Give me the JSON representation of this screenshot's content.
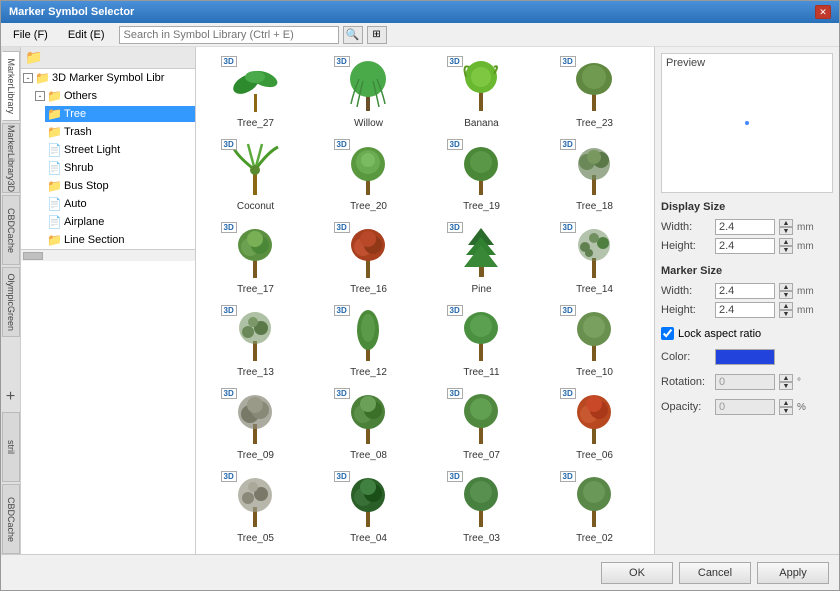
{
  "window": {
    "title": "Marker Symbol Selector",
    "close_btn": "✕"
  },
  "menu": {
    "file": "File (F)",
    "edit": "Edit (E)",
    "search_placeholder": "Search in Symbol Library (Ctrl + E)"
  },
  "tree": {
    "root": "3D Marker Symbol Libr",
    "items": [
      {
        "label": "Others",
        "type": "folder",
        "level": 1
      },
      {
        "label": "Tree",
        "type": "folder",
        "level": 2,
        "selected": true
      },
      {
        "label": "Trash",
        "type": "folder",
        "level": 2
      },
      {
        "label": "Street Light",
        "type": "folder",
        "level": 2
      },
      {
        "label": "Shrub",
        "type": "folder",
        "level": 2
      },
      {
        "label": "Bus Stop",
        "type": "folder",
        "level": 2
      },
      {
        "label": "Auto",
        "type": "folder",
        "level": 2
      },
      {
        "label": "Airplane",
        "type": "folder",
        "level": 2
      },
      {
        "label": "Line Section",
        "type": "folder",
        "level": 2
      }
    ]
  },
  "symbols": [
    {
      "label": "Tree_27",
      "badge": "3D",
      "shape": "palm"
    },
    {
      "label": "Willow",
      "badge": "3D",
      "shape": "willow"
    },
    {
      "label": "Banana",
      "badge": "3D",
      "shape": "banana"
    },
    {
      "label": "Tree_23",
      "badge": "3D",
      "shape": "roundtree"
    },
    {
      "label": "Coconut",
      "badge": "3D",
      "shape": "coconut"
    },
    {
      "label": "Tree_20",
      "badge": "3D",
      "shape": "roundtree2"
    },
    {
      "label": "Tree_19",
      "badge": "3D",
      "shape": "roundtree3"
    },
    {
      "label": "Tree_18",
      "badge": "3D",
      "shape": "roundtree4"
    },
    {
      "label": "Tree_17",
      "badge": "3D",
      "shape": "greentree"
    },
    {
      "label": "Tree_16",
      "badge": "3D",
      "shape": "redtree"
    },
    {
      "label": "Pine",
      "badge": "3D",
      "shape": "pinetree"
    },
    {
      "label": "Tree_14",
      "badge": "3D",
      "shape": "sparsetree"
    },
    {
      "label": "Tree_13",
      "badge": "3D",
      "shape": "sparsetree2"
    },
    {
      "label": "Tree_12",
      "badge": "3D",
      "shape": "talltree"
    },
    {
      "label": "Tree_11",
      "badge": "3D",
      "shape": "greentree2"
    },
    {
      "label": "Tree_10",
      "badge": "3D",
      "shape": "roundtree5"
    },
    {
      "label": "Tree_09",
      "badge": "3D",
      "shape": "greytree"
    },
    {
      "label": "Tree_08",
      "badge": "3D",
      "shape": "greentree3"
    },
    {
      "label": "Tree_07",
      "badge": "3D",
      "shape": "greentree4"
    },
    {
      "label": "Tree_06",
      "badge": "3D",
      "shape": "redtree2"
    },
    {
      "label": "Tree_05",
      "badge": "3D",
      "shape": "greytree2"
    },
    {
      "label": "Tree_04",
      "badge": "3D",
      "shape": "darktree"
    },
    {
      "label": "Tree_03",
      "badge": "3D",
      "shape": "greentree5"
    },
    {
      "label": "Tree_02",
      "badge": "3D",
      "shape": "greentree6"
    }
  ],
  "preview": {
    "label": "Preview"
  },
  "properties": {
    "display_size_label": "Display Size",
    "marker_size_label": "Marker Size",
    "width_label": "Width:",
    "height_label": "Height:",
    "display_width_val": "2.4",
    "display_height_val": "2.4",
    "marker_width_val": "2.4",
    "marker_height_val": "2.4",
    "unit": "mm",
    "lock_label": "Lock aspect ratio",
    "color_label": "Color:",
    "rotation_label": "Rotation:",
    "rotation_val": "0",
    "rotation_unit": "°",
    "opacity_label": "Opacity:",
    "opacity_val": "0",
    "opacity_unit": "%"
  },
  "buttons": {
    "ok": "OK",
    "cancel": "Cancel",
    "apply": "Apply"
  },
  "side_tabs": [
    "MarkerLibrary",
    "MarkerLibrary3D",
    "CBDCache",
    "OlympicGreen",
    "stril",
    "CBDCache"
  ]
}
